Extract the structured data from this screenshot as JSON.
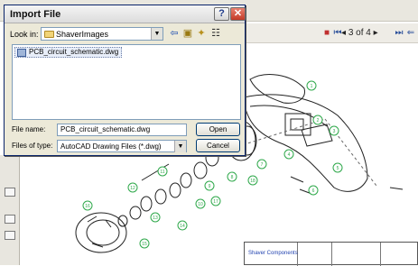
{
  "dialog": {
    "title": "Import File",
    "help_label": "?",
    "close_label": "✕",
    "look_in_label": "Look in:",
    "look_in_value": "ShaverImages",
    "toolbar_icons": [
      "back-icon",
      "up-folder-icon",
      "new-folder-icon",
      "views-icon"
    ],
    "files": [
      "PCB_circuit_schematic.dwg"
    ],
    "file_name_label": "File name:",
    "file_name_value": "PCB_circuit_schematic.dwg",
    "file_type_label": "Files of type:",
    "file_type_value": "AutoCAD Drawing Files (*.dwg)",
    "open_label": "Open",
    "cancel_label": "Cancel"
  },
  "viewer": {
    "page_indicator": "3 of 4"
  },
  "drawing": {
    "part_callouts": [
      "1",
      "2",
      "3",
      "4",
      "5",
      "6",
      "7",
      "8",
      "9",
      "10",
      "11",
      "12",
      "13",
      "14",
      "15",
      "16",
      "17",
      "18"
    ],
    "title_block_text": "Shaver Components"
  },
  "colors": {
    "dialog_border": "#0a246a",
    "callout_green": "#2ea84a",
    "close_red": "#c23a26"
  }
}
